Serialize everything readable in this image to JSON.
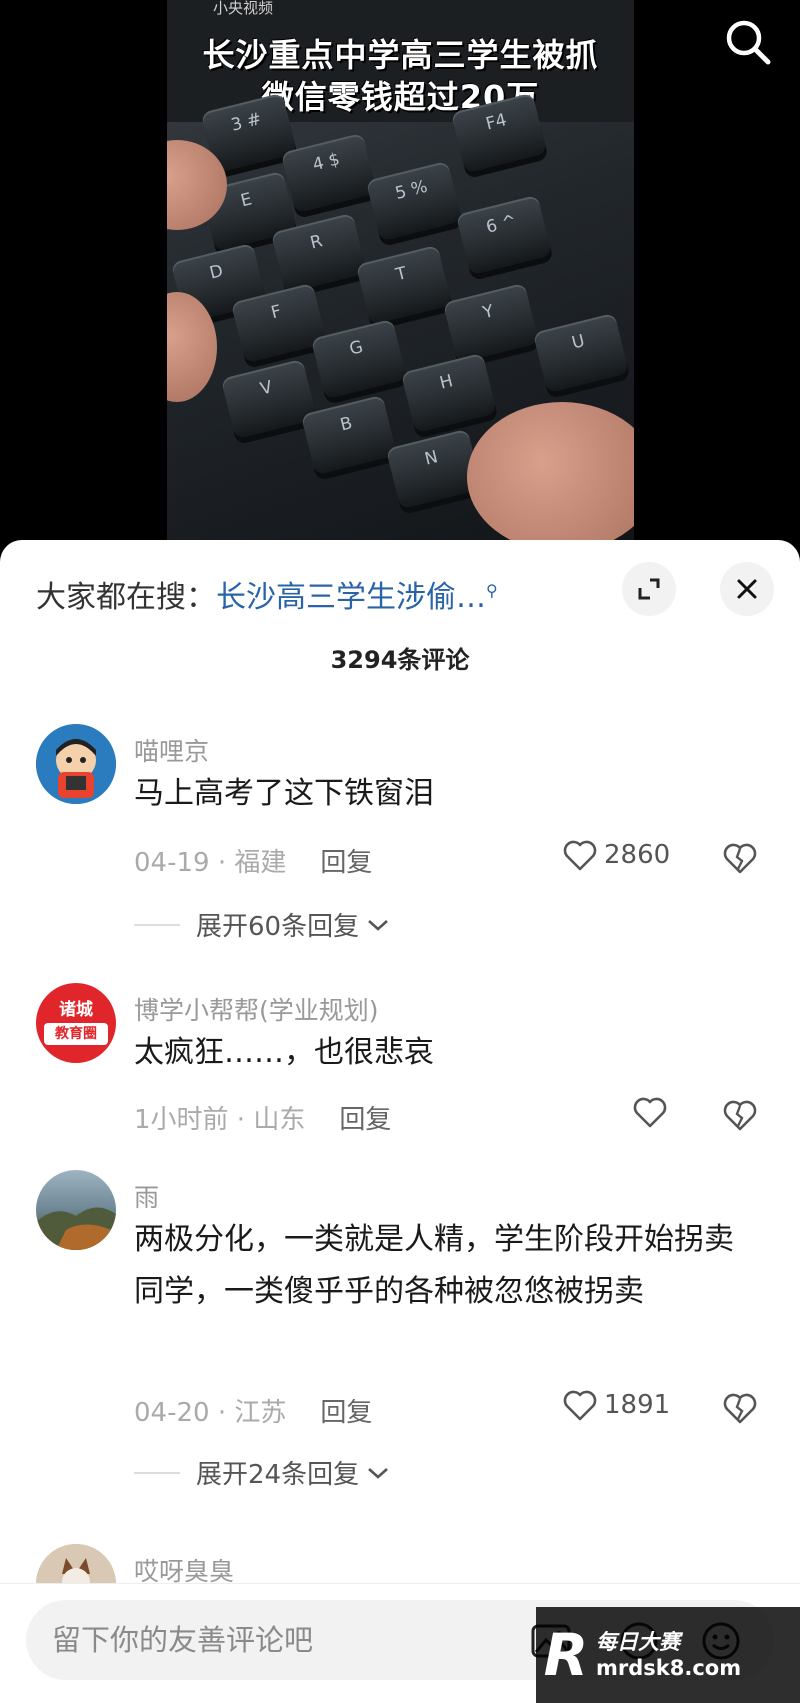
{
  "video": {
    "watermark": "小央视频",
    "title_line1": "长沙重点中学高三学生被抓",
    "title_line2": "微信零钱超过20万",
    "keys": [
      "3 #",
      "F4",
      "4 $",
      "5 %",
      "6 ^",
      "E",
      "R",
      "T",
      "D",
      "F",
      "G",
      "Y",
      "U",
      "H",
      "V",
      "B",
      "N"
    ]
  },
  "top_bar": {
    "search_icon": "search-icon"
  },
  "sheet": {
    "hot_search_prefix": "大家都在搜：",
    "hot_search_link": "长沙高三学生涉偷…",
    "expand_icon": "fullscreen-icon",
    "close_icon": "close-icon",
    "comment_count_title": "3294条评论"
  },
  "comments": [
    {
      "name": "喵哩京",
      "text": "马上高考了这下铁窗泪",
      "meta": "04-19 · 福建",
      "reply_label": "回复",
      "likes": "2860",
      "expand_label": "展开60条回复"
    },
    {
      "name": "博学小帮帮(学业规划)",
      "avatar_text_top": "诸城",
      "avatar_text_bottom": "教育圈",
      "text": "太疯狂……，也很悲哀",
      "meta": "1小时前 · 山东",
      "reply_label": "回复"
    },
    {
      "name": "雨",
      "text": "两极分化，一类就是人精，学生阶段开始拐卖同学，一类傻乎乎的各种被忽悠被拐卖",
      "meta": "04-20 · 江苏",
      "reply_label": "回复",
      "likes": "1891",
      "expand_label": "展开24条回复"
    },
    {
      "name": "哎呀臭臭"
    }
  ],
  "input": {
    "placeholder": "留下你的友善评论吧",
    "image_icon": "image-icon",
    "emoji_icon": "emoji-icon"
  },
  "brand": {
    "logo": "R",
    "name": "每日大赛",
    "site": "mrdsk8.com"
  },
  "colors": {
    "link": "#2a64a8",
    "meta": "#aaaaaa",
    "sheet_bg": "#ffffff",
    "avatar_red": "#e0262a"
  }
}
